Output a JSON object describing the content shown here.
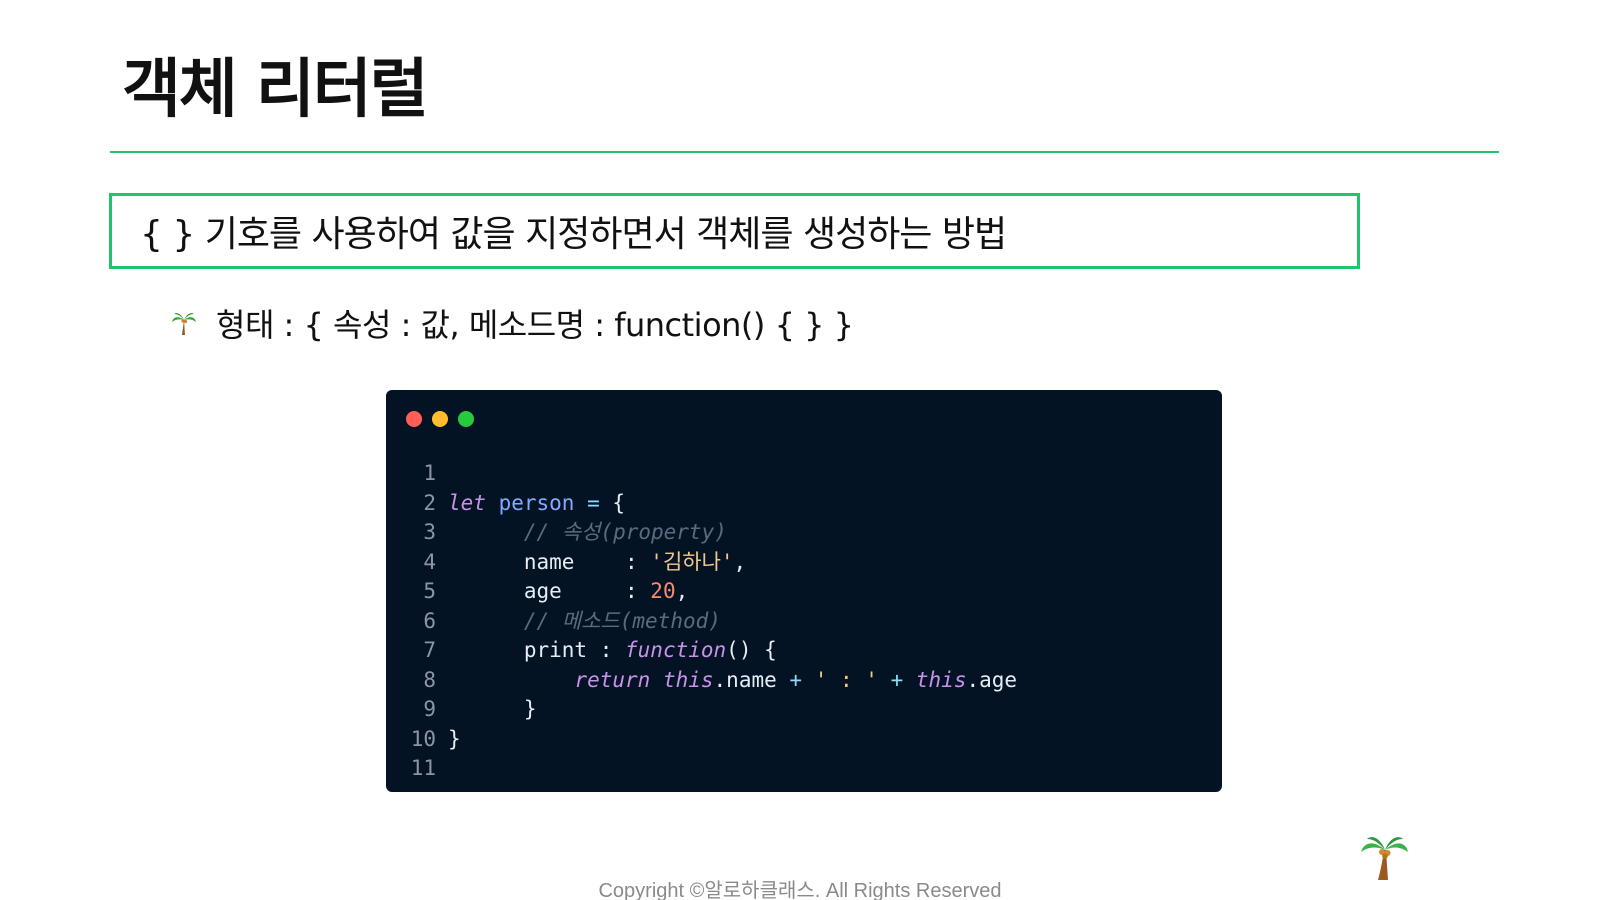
{
  "slide": {
    "title": "객체 리터럴",
    "definition": "{  } 기호를 사용하여 값을 지정하면서 객체를 생성하는 방법",
    "bullet": {
      "icon": "palm-tree-icon",
      "text": "형태 : { 속성 : 값, 메소드명 : function() { } }"
    },
    "footer": {
      "copyright": "Copyright ©알로하클래스. All Rights Reserved",
      "logo_icon": "palm-tree-icon"
    }
  },
  "code_window": {
    "dot_colors": [
      "#ff5f56",
      "#ffbd2e",
      "#27c93f"
    ],
    "lines": [
      {
        "num": "1",
        "tokens": []
      },
      {
        "num": "2",
        "tokens": [
          [
            "kw",
            "let"
          ],
          [
            "plain",
            " "
          ],
          [
            "var",
            "person"
          ],
          [
            "plain",
            " "
          ],
          [
            "op",
            "="
          ],
          [
            "plain",
            " {"
          ]
        ]
      },
      {
        "num": "3",
        "tokens": [
          [
            "plain",
            "      "
          ],
          [
            "cm",
            "// 속성(property)"
          ]
        ]
      },
      {
        "num": "4",
        "tokens": [
          [
            "plain",
            "      name    : "
          ],
          [
            "str",
            "'김하나'"
          ],
          [
            "plain",
            ","
          ]
        ]
      },
      {
        "num": "5",
        "tokens": [
          [
            "plain",
            "      age     : "
          ],
          [
            "num",
            "20"
          ],
          [
            "plain",
            ","
          ]
        ]
      },
      {
        "num": "6",
        "tokens": [
          [
            "plain",
            "      "
          ],
          [
            "cm",
            "// 메소드(method)"
          ]
        ]
      },
      {
        "num": "7",
        "tokens": [
          [
            "plain",
            "      print : "
          ],
          [
            "kw",
            "function"
          ],
          [
            "plain",
            "() {"
          ]
        ]
      },
      {
        "num": "8",
        "tokens": [
          [
            "plain",
            "          "
          ],
          [
            "kw",
            "return"
          ],
          [
            "plain",
            " "
          ],
          [
            "kw",
            "this"
          ],
          [
            "plain",
            ".name "
          ],
          [
            "op",
            "+"
          ],
          [
            "plain",
            " "
          ],
          [
            "str",
            "' : '"
          ],
          [
            "plain",
            " "
          ],
          [
            "op",
            "+"
          ],
          [
            "plain",
            " "
          ],
          [
            "kw",
            "this"
          ],
          [
            "plain",
            ".age"
          ]
        ]
      },
      {
        "num": "9",
        "tokens": [
          [
            "plain",
            "      }"
          ]
        ]
      },
      {
        "num": "10",
        "tokens": [
          [
            "plain",
            "}"
          ]
        ]
      },
      {
        "num": "11",
        "tokens": []
      }
    ]
  },
  "colors": {
    "accent": "#22c36a",
    "code_background": "#041324"
  }
}
